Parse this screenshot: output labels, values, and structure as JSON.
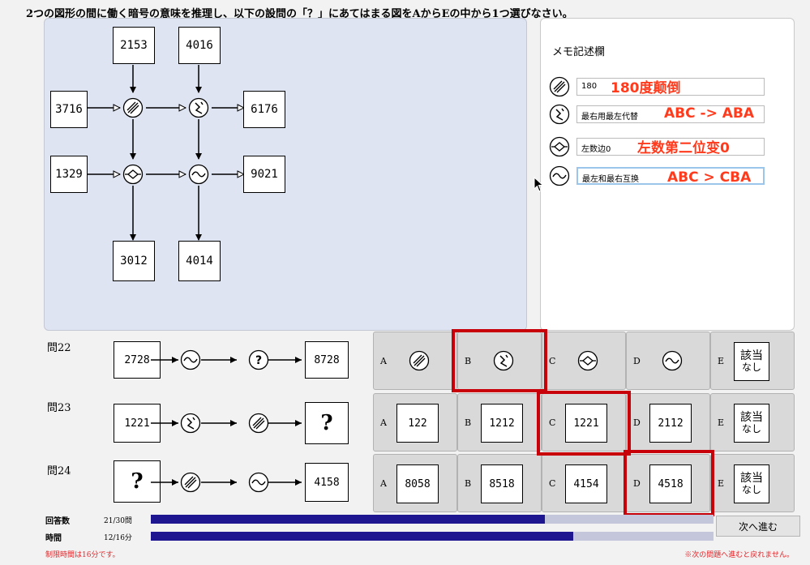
{
  "instruction": "2つの図形の間に働く暗号の意味を推理し、以下の設問の「？」にあてはまる図をAからEの中から1つ選びなさい。",
  "diagram": {
    "top_left": "2153",
    "top_right": "4016",
    "left_top": "3716",
    "right_top": "6176",
    "left_bottom": "1329",
    "right_bottom": "9021",
    "bottom_left": "3012",
    "bottom_right": "4014"
  },
  "memo": {
    "title": "メモ記述欄",
    "rows": [
      {
        "icon": "slash-circle-icon",
        "field": "180",
        "note": "180度颠倒"
      },
      {
        "icon": "s-circle-icon",
        "field": "最右用最左代替",
        "note": "ABC -> ABA"
      },
      {
        "icon": "diamond-circle-icon",
        "field": "左数边0",
        "note": "左数第二位变0"
      },
      {
        "icon": "wave-circle-icon",
        "field": "最左和最右互换",
        "note": "ABC > CBA"
      }
    ]
  },
  "questions": [
    {
      "label": "問22",
      "left": "2728",
      "right": "8728",
      "options": [
        {
          "letter": "A",
          "icon": "slash-circle-icon"
        },
        {
          "letter": "B",
          "icon": "s-circle-icon"
        },
        {
          "letter": "C",
          "icon": "diamond-circle-icon"
        },
        {
          "letter": "D",
          "icon": "wave-circle-icon"
        },
        {
          "letter": "E",
          "nashi_top": "該当",
          "nashi_bottom": "なし"
        }
      ]
    },
    {
      "label": "問23",
      "left": "1221",
      "right": "?",
      "options": [
        {
          "letter": "A",
          "value": "122"
        },
        {
          "letter": "B",
          "value": "1212"
        },
        {
          "letter": "C",
          "value": "1221"
        },
        {
          "letter": "D",
          "value": "2112"
        },
        {
          "letter": "E",
          "nashi_top": "該当",
          "nashi_bottom": "なし"
        }
      ]
    },
    {
      "label": "問24",
      "left": "?",
      "right": "4158",
      "options": [
        {
          "letter": "A",
          "value": "8058"
        },
        {
          "letter": "B",
          "value": "8518"
        },
        {
          "letter": "C",
          "value": "4154"
        },
        {
          "letter": "D",
          "value": "4518"
        },
        {
          "letter": "E",
          "nashi_top": "該当",
          "nashi_bottom": "なし"
        }
      ]
    }
  ],
  "status": {
    "answered_label": "回答数",
    "answered_value": "21/30問",
    "answered_fraction": 0.7,
    "time_label": "時間",
    "time_value": "12/16分",
    "time_fraction": 0.75,
    "next_button": "次へ進む",
    "footer_left": "制限時間は16分です。",
    "footer_right": "※次の問題へ進むと戻れません。"
  },
  "colors": {
    "bar_fill": "#1e1690",
    "highlight": "#c8000a",
    "memo_note": "#ff3b1e"
  }
}
